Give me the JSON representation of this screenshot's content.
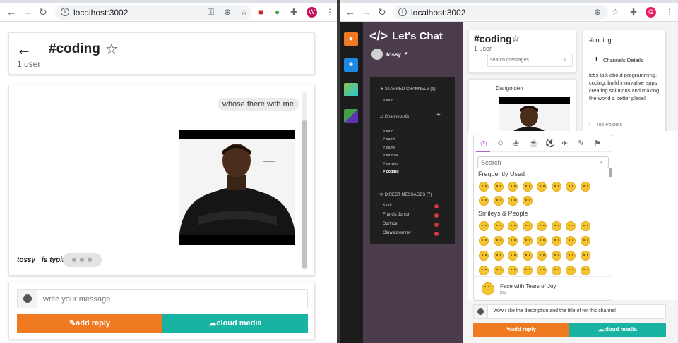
{
  "left_browser": {
    "url": "localhost:3002",
    "profile_initial": "W",
    "profile_color": "#c2185b"
  },
  "left_app": {
    "channel_title": "#coding",
    "user_count": "1 user",
    "messages": [
      {
        "text": "whose there with me"
      }
    ],
    "typing_user": "tossy",
    "typing_text": "is typing",
    "input_placeholder": "write your message",
    "add_reply_label": "add reply",
    "cloud_media_label": "cloud media"
  },
  "right_browser": {
    "url": "localhost:3002",
    "profile_initial": "G",
    "profile_color": "#e91e63"
  },
  "right_app": {
    "brand": "Let's Chat",
    "username": "tossy",
    "starred_label": "STARRED CHANNELS (1)",
    "starred": [
      "# food"
    ],
    "channels_label": "Channels (6)",
    "channels": [
      "# food",
      "# sport",
      "# game",
      "# football",
      "# movies",
      "# coding"
    ],
    "dm_label": "DIRECT MESSAGES (7)",
    "dms": [
      "Kkkk",
      "Francis Junior",
      "Dprince",
      "Oluwaphemmy"
    ],
    "channel_title": "#coding",
    "user_count": "1 user",
    "search_placeholder": "search messages",
    "message_author": "Dangolden",
    "details_header": "#coding",
    "details_title": "Channels Details",
    "details_body": "let's talk about programming, coding, build innovative apps, creating solutions and making the world a better place!",
    "top_posters": "Top Posters",
    "emoji_search_placeholder": "Search",
    "frequently_used_label": "Frequently Used",
    "smileys_label": "Smileys & People",
    "emoji_preview_name": "Face with Tears of Joy",
    "emoji_preview_code": "joy",
    "message_input_value": "wow i like the description and the title of for this channel",
    "add_reply_label": "add reply",
    "cloud_media_label": "cloud media"
  },
  "colors": {
    "orange": "#f07a22",
    "teal": "#17b3a3",
    "purple_sidebar": "#4b3c4c"
  }
}
